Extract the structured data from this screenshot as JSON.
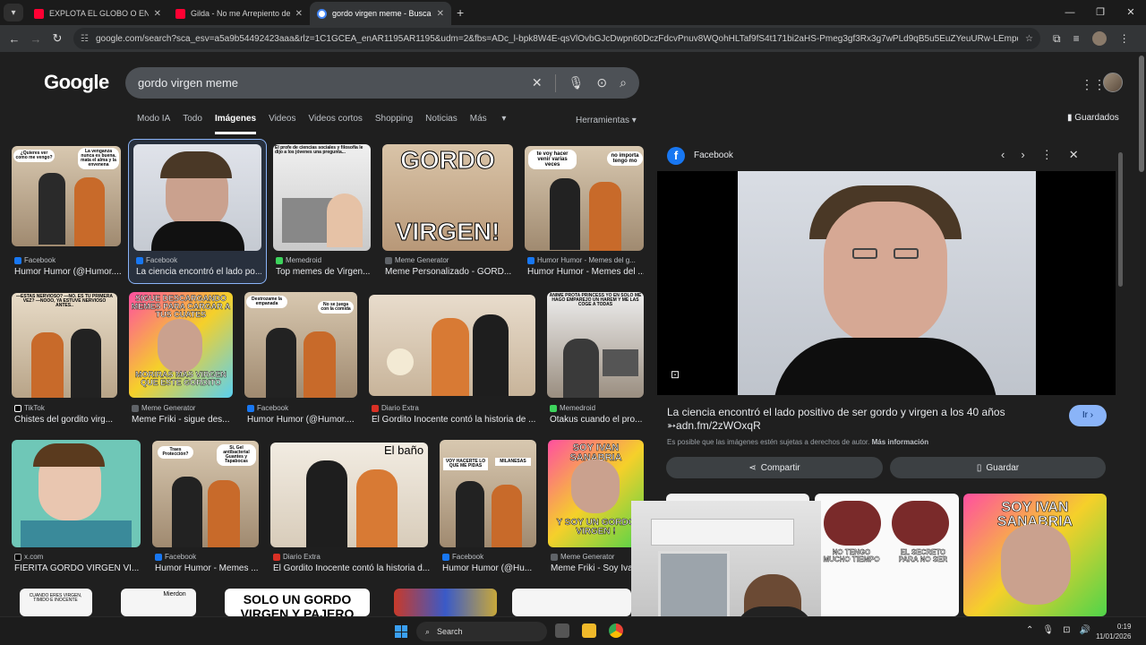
{
  "browser": {
    "tabs": [
      {
        "title": "EXPLOTA EL GLOBO O ENCUEN",
        "type": "yt"
      },
      {
        "title": "Gilda - No me Arrepiento de e",
        "type": "yt"
      },
      {
        "title": "gordo virgen meme - Buscar c",
        "type": "g"
      }
    ],
    "url": "google.com/search?sca_esv=a5a9b54492423aaa&rlz=1C1GCEA_enAR1195AR1195&udm=2&fbs=ADc_l-bpk8W4E-qsVlOvbGJcDwpn60DczFdcvPnuv8WQohHLTaf9fS4t171bi2aHS-Pmeg3gf3Rx3g7wPLd9qB5u5EuZYeuURw-LEmpdoZ-f8DEVyumGGLE-..."
  },
  "search": {
    "query": "gordo virgen meme",
    "logo": "Google"
  },
  "nav": {
    "tabs": [
      "Modo IA",
      "Todo",
      "Imágenes",
      "Videos",
      "Videos cortos",
      "Shopping",
      "Noticias",
      "Más"
    ],
    "tools": "Herramientas",
    "saved": "Guardados"
  },
  "results": [
    {
      "source": "Facebook",
      "caption": "Humor Humor (@Humor...."
    },
    {
      "source": "Facebook",
      "caption": "La ciencia encontró el lado po..."
    },
    {
      "source": "Memedroid",
      "caption": "Top memes de Virgen..."
    },
    {
      "source": "Meme Generator",
      "caption": "Meme Personalizado - GORD..."
    },
    {
      "source": "Humor Humor - Memes del g...",
      "caption": "Humor Humor - Memes del ..."
    },
    {
      "source": "TikTok",
      "caption": "Chistes del gordito virg..."
    },
    {
      "source": "Meme Generator",
      "caption": "Meme Friki - sigue des..."
    },
    {
      "source": "Facebook",
      "caption": "Humor Humor (@Humor...."
    },
    {
      "source": "Diario Extra",
      "caption": "El Gordito Inocente contó la historia de ..."
    },
    {
      "source": "Memedroid",
      "caption": "Otakus cuando el pro..."
    },
    {
      "source": "x.com",
      "caption": "FIERITA GORDO VIRGEN VI..."
    },
    {
      "source": "Facebook",
      "caption": "Humor Humor - Memes ..."
    },
    {
      "source": "Diario Extra",
      "caption": "El Gordito Inocente contó la historia d..."
    },
    {
      "source": "Facebook",
      "caption": "Humor Humor (@Hu..."
    },
    {
      "source": "Meme Generator",
      "caption": "Meme Friki - Soy Iva..."
    }
  ],
  "meme_text": {
    "t1a": "¿Quieres ver como me vengo?",
    "t1b": "La venganza nunca es buena, mata el alma y la envenena",
    "t3": "El profe de ciencias sociales y filosofía le dijo a los jóvenes una pregunta...",
    "t4a": "GORDO",
    "t4b": "VIRGEN!",
    "t5a": "te voy hacer venir varias veces",
    "t5b": "no importa tengo mo",
    "t6": "—ESTAS NERVIOSO? —NO. ES TU PRIMERA VEZ? —NOOO, YA ESTUVE NERVIOSO ANTES..",
    "t7a": "SIGUE DESCARGANDO MEMES PARA CARGAR A TUS CUATES",
    "t7b": "MORIRAS MAS VIRGEN QUE ESTE GORDITO",
    "t8a": "Destrozame la empanada",
    "t8b": "No se juega con la comida",
    "t10": "ANIME PROTA PRINCESS YO EN SOLO ME HAGO EMPAREJO UN HAREM Y ME LAS COGE A TODAS",
    "t12a": "Traes Protección?",
    "t12b": "Si, Gel antibacterial Guantes y Tapabocas",
    "t13": "El baño",
    "t14a": "VOY HACERTE LO QUE ME PIDAS",
    "t14b": "MILANESAS",
    "t15a": "SOY IVAN SANABRIA",
    "t15b": "Y SOY UN GORDO VIRGEN !",
    "r4a": "CUANDO ERES VIRGEN, TIMIDO E INOCENTE",
    "r4b": "Mierdon",
    "r4c": "SOLO UN GORDO VIRGEN Y PAJERO"
  },
  "panel": {
    "source": "Facebook",
    "title": "La ciencia encontró el lado positivo de ser gordo y virgen a los 40 años ➳adn.fm/2zWOxqR",
    "go": "Ir",
    "copyright": "Es posible que las imágenes estén sujetas a derechos de autor.",
    "more_info": "Más información",
    "share": "Compartir",
    "save": "Guardar",
    "related": [
      "NO TENGO MUCHO TIEMPO",
      "EL SECRETO PARA NO SER",
      "SOY IVAN SANABRIA"
    ]
  },
  "taskbar": {
    "search": "Search",
    "time": "0:19",
    "date": "11/01/2026"
  },
  "colors": {
    "accent": "#8ab4f8",
    "bg": "#1f1f1f",
    "facebook": "#1877f2"
  }
}
